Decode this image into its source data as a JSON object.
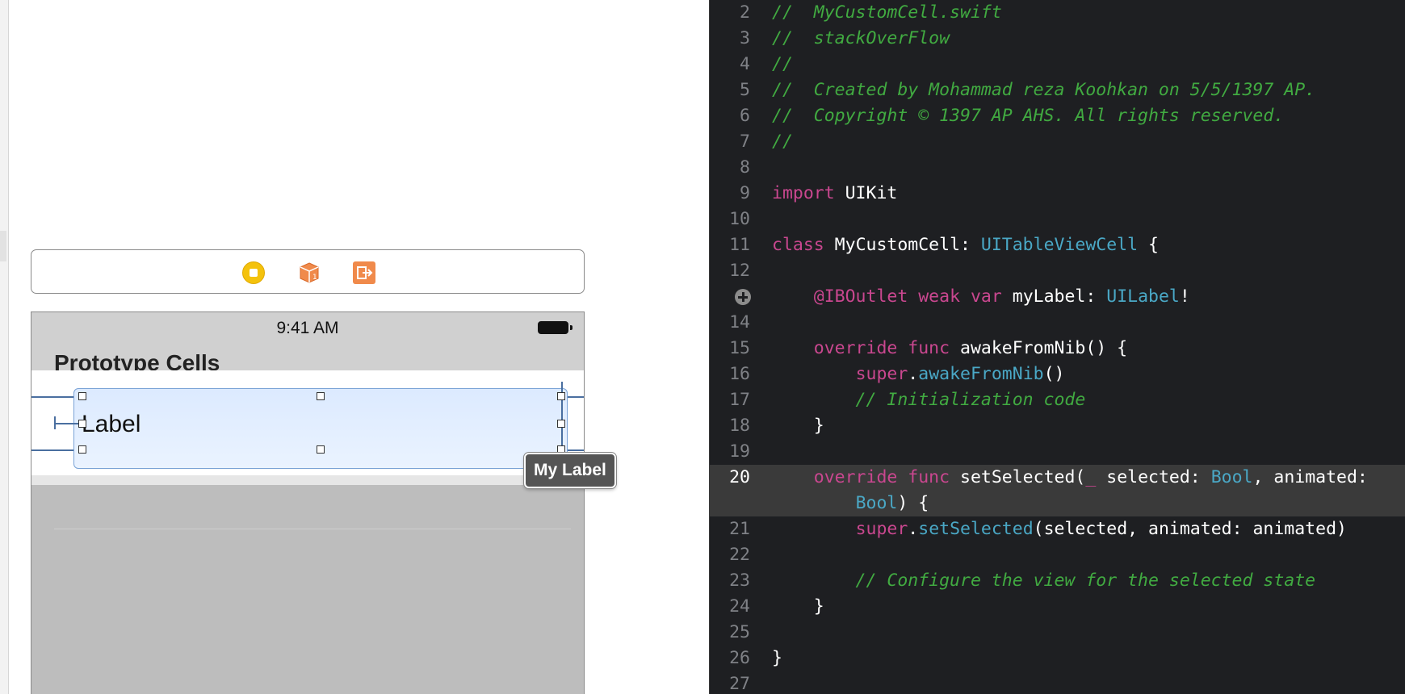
{
  "interface_builder": {
    "scene_dock": {
      "icons": [
        "view-controller-icon",
        "first-responder-cube-icon",
        "exit-icon"
      ]
    },
    "status_bar": {
      "time": "9:41 AM"
    },
    "nav_bar": {
      "section_title": "Prototype Cells"
    },
    "cell": {
      "label_text": "Label"
    },
    "tooltip": {
      "text": "My Label"
    }
  },
  "editor": {
    "colors": {
      "comment": "#41aa41",
      "keyword": "#c9478f",
      "type": "#4aa8c6",
      "plain": "#ffffff"
    },
    "lines": [
      {
        "num": "2",
        "tokens": [
          {
            "t": "//  MyCustomCell.swift",
            "k": "comment"
          }
        ]
      },
      {
        "num": "3",
        "tokens": [
          {
            "t": "//  stackOverFlow",
            "k": "comment"
          }
        ]
      },
      {
        "num": "4",
        "tokens": [
          {
            "t": "//",
            "k": "comment"
          }
        ]
      },
      {
        "num": "5",
        "tokens": [
          {
            "t": "//  Created by Mohammad reza Koohkan on 5/5/1397 AP.",
            "k": "comment"
          }
        ]
      },
      {
        "num": "6",
        "tokens": [
          {
            "t": "//  Copyright © 1397 AP AHS. All rights reserved.",
            "k": "comment"
          }
        ]
      },
      {
        "num": "7",
        "tokens": [
          {
            "t": "//",
            "k": "comment"
          }
        ]
      },
      {
        "num": "8",
        "tokens": []
      },
      {
        "num": "9",
        "tokens": [
          {
            "t": "import",
            "k": "kw"
          },
          {
            "t": " UIKit",
            "k": "plain"
          }
        ]
      },
      {
        "num": "10",
        "tokens": []
      },
      {
        "num": "11",
        "tokens": [
          {
            "t": "class",
            "k": "kw"
          },
          {
            "t": " MyCustomCell: ",
            "k": "plain"
          },
          {
            "t": "UITableViewCell",
            "k": "type"
          },
          {
            "t": " {",
            "k": "plain"
          }
        ]
      },
      {
        "num": "12",
        "tokens": []
      },
      {
        "num": "",
        "outlet": true,
        "tokens": [
          {
            "t": "    ",
            "k": "plain"
          },
          {
            "t": "@IBOutlet",
            "k": "kw"
          },
          {
            "t": " ",
            "k": "plain"
          },
          {
            "t": "weak",
            "k": "kw"
          },
          {
            "t": " ",
            "k": "plain"
          },
          {
            "t": "var",
            "k": "kw"
          },
          {
            "t": " myLabel: ",
            "k": "plain"
          },
          {
            "t": "UILabel",
            "k": "type"
          },
          {
            "t": "!",
            "k": "plain"
          }
        ]
      },
      {
        "num": "14",
        "tokens": []
      },
      {
        "num": "15",
        "tokens": [
          {
            "t": "    ",
            "k": "plain"
          },
          {
            "t": "override",
            "k": "kw"
          },
          {
            "t": " ",
            "k": "plain"
          },
          {
            "t": "func",
            "k": "kw"
          },
          {
            "t": " awakeFromNib() {",
            "k": "plain"
          }
        ]
      },
      {
        "num": "16",
        "tokens": [
          {
            "t": "        ",
            "k": "plain"
          },
          {
            "t": "super",
            "k": "kw"
          },
          {
            "t": ".",
            "k": "plain"
          },
          {
            "t": "awakeFromNib",
            "k": "type"
          },
          {
            "t": "()",
            "k": "plain"
          }
        ]
      },
      {
        "num": "17",
        "tokens": [
          {
            "t": "        // Initialization code",
            "k": "comment"
          }
        ]
      },
      {
        "num": "18",
        "tokens": [
          {
            "t": "    }",
            "k": "plain"
          }
        ]
      },
      {
        "num": "19",
        "tokens": []
      },
      {
        "num": "20",
        "current": true,
        "tokens": [
          {
            "t": "    ",
            "k": "plain"
          },
          {
            "t": "override",
            "k": "kw"
          },
          {
            "t": " ",
            "k": "plain"
          },
          {
            "t": "func",
            "k": "kw"
          },
          {
            "t": " setSelected(",
            "k": "plain"
          },
          {
            "t": "_",
            "k": "kw"
          },
          {
            "t": " selected: ",
            "k": "plain"
          },
          {
            "t": "Bool",
            "k": "type"
          },
          {
            "t": ", animated:",
            "k": "plain"
          }
        ]
      },
      {
        "num": "",
        "wrap": true,
        "tokens": [
          {
            "t": "        ",
            "k": "plain"
          },
          {
            "t": "Bool",
            "k": "type"
          },
          {
            "t": ") {",
            "k": "plain"
          }
        ]
      },
      {
        "num": "21",
        "tokens": [
          {
            "t": "        ",
            "k": "plain"
          },
          {
            "t": "super",
            "k": "kw"
          },
          {
            "t": ".",
            "k": "plain"
          },
          {
            "t": "setSelected",
            "k": "type"
          },
          {
            "t": "(selected, animated: animated)",
            "k": "plain"
          }
        ]
      },
      {
        "num": "22",
        "tokens": []
      },
      {
        "num": "23",
        "tokens": [
          {
            "t": "        // Configure the view for the selected state",
            "k": "comment"
          }
        ]
      },
      {
        "num": "24",
        "tokens": [
          {
            "t": "    }",
            "k": "plain"
          }
        ]
      },
      {
        "num": "25",
        "tokens": []
      },
      {
        "num": "26",
        "tokens": [
          {
            "t": "}",
            "k": "plain"
          }
        ]
      },
      {
        "num": "27",
        "tokens": []
      }
    ]
  }
}
